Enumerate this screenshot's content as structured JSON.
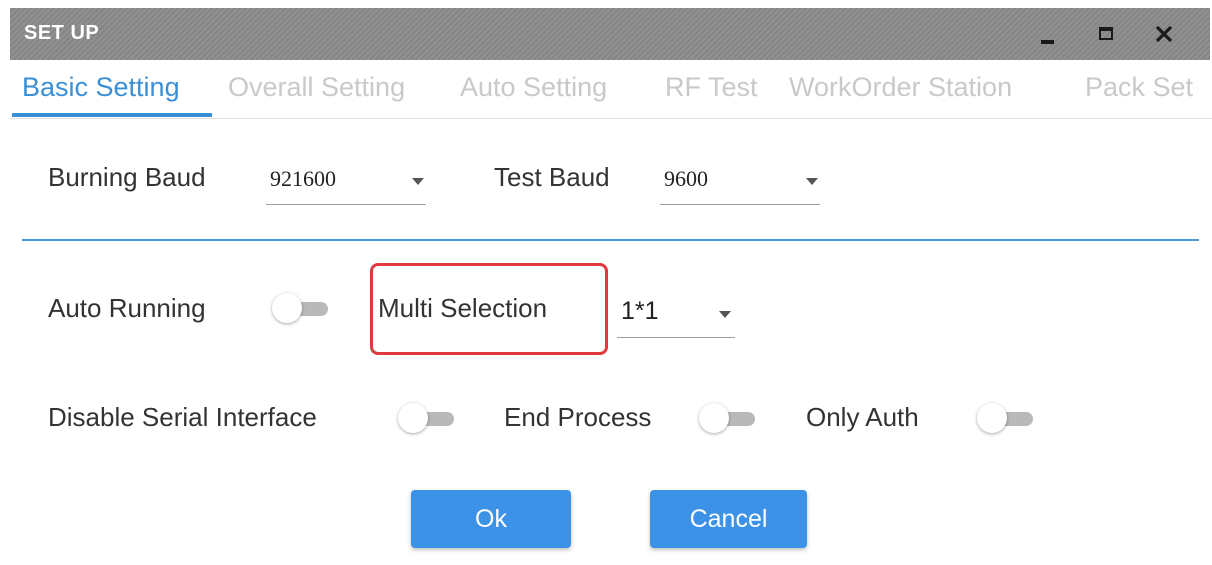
{
  "window": {
    "title": "SET UP",
    "controls": [
      "minimize-icon",
      "maximize-icon",
      "close-icon"
    ]
  },
  "tabs": [
    {
      "label": "Basic Setting",
      "active": true
    },
    {
      "label": "Overall Setting",
      "active": false
    },
    {
      "label": "Auto Setting",
      "active": false
    },
    {
      "label": "RF Test",
      "active": false
    },
    {
      "label": "WorkOrder Station",
      "active": false
    },
    {
      "label": "Pack Set",
      "active": false
    }
  ],
  "baud": {
    "burning_label": "Burning Baud",
    "burning_value": "921600",
    "test_label": "Test Baud",
    "test_value": "9600"
  },
  "options": {
    "auto_running_label": "Auto Running",
    "auto_running_on": false,
    "multi_selection_label": "Multi Selection",
    "multi_selection_value": "1*1",
    "disable_serial_label": "Disable Serial Interface",
    "disable_serial_on": false,
    "end_process_label": "End Process",
    "end_process_on": false,
    "only_auth_label": "Only Auth",
    "only_auth_on": false
  },
  "buttons": {
    "ok_label": "Ok",
    "cancel_label": "Cancel"
  },
  "colors": {
    "accent": "#3b8fd4",
    "button": "#3b92e6",
    "highlight_border": "#e0393e",
    "titlebar": "#8a8a8a"
  }
}
